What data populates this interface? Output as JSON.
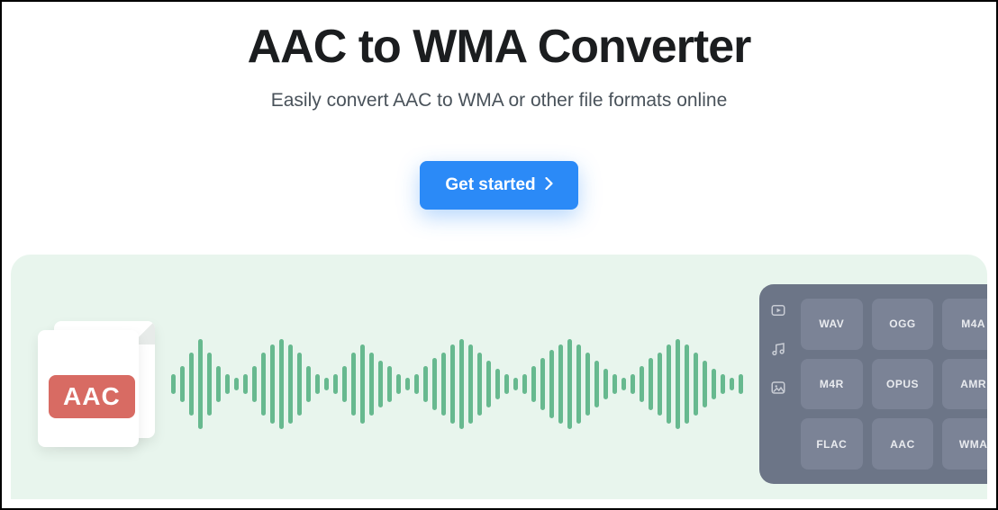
{
  "hero": {
    "title": "AAC to WMA Converter",
    "subtitle": "Easily convert AAC to WMA or other file formats online",
    "cta_label": "Get started"
  },
  "source_format_badge": "AAC",
  "formats": [
    "WAV",
    "OGG",
    "M4A",
    "M4R",
    "OPUS",
    "AMR",
    "FLAC",
    "AAC",
    "WMA"
  ],
  "waveform_heights": [
    22,
    40,
    70,
    100,
    70,
    40,
    22,
    14,
    22,
    40,
    70,
    88,
    100,
    88,
    70,
    40,
    22,
    14,
    22,
    40,
    70,
    88,
    70,
    52,
    40,
    22,
    14,
    22,
    40,
    58,
    70,
    88,
    100,
    88,
    70,
    52,
    34,
    22,
    14,
    22,
    40,
    58,
    76,
    88,
    100,
    88,
    70,
    52,
    34,
    22,
    14,
    22,
    40,
    58,
    70,
    88,
    100,
    88,
    70,
    52,
    34,
    22,
    14,
    22
  ]
}
